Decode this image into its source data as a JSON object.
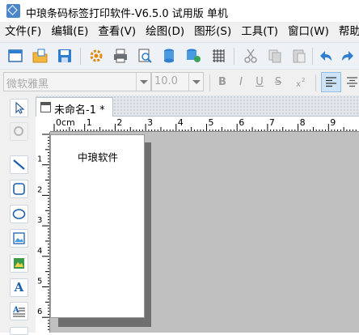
{
  "title_bar": {
    "title": "中琅条码标签打印软件-V6.5.0 试用版 单机",
    "logo_icon": "app-logo-icon"
  },
  "menu": {
    "items": [
      {
        "label": "文件(F)"
      },
      {
        "label": "编辑(E)"
      },
      {
        "label": "查看(V)"
      },
      {
        "label": "绘图(D)"
      },
      {
        "label": "图形(S)"
      },
      {
        "label": "工具(T)"
      },
      {
        "label": "窗口(W)"
      },
      {
        "label": "帮助"
      }
    ]
  },
  "toolbar": {
    "icons": [
      "new-icon",
      "open-icon",
      "save-icon",
      "settings-icon",
      "print-icon",
      "print-preview-icon",
      "database-icon",
      "database-settings-icon",
      "grid-icon",
      "cut-icon",
      "copy-icon",
      "paste-icon",
      "undo-icon",
      "redo-icon"
    ]
  },
  "format_bar": {
    "font_name": "微软雅黑",
    "font_size": "10.0",
    "bold": "B",
    "italic": "I",
    "underline": "U",
    "strike": "S",
    "superscript_icon": "superscript-icon",
    "align_left_icon": "align-left-icon",
    "align_center_icon": "align-center-icon"
  },
  "tools": {
    "icons": [
      "select-arrow-icon",
      "rotate-icon",
      "line-icon",
      "rounded-rect-icon",
      "ellipse-icon",
      "image-icon",
      "picture-icon",
      "text-icon",
      "rich-text-icon"
    ],
    "text_tool_glyph": "A"
  },
  "document": {
    "tab_title": "未命名-1 *",
    "ruler_unit": "cm",
    "ruler_numbers": [
      "0",
      "1",
      "2",
      "3",
      "4",
      "5",
      "6",
      "7",
      "8",
      "9"
    ],
    "label_text": "中琅软件"
  },
  "colors": {
    "accent": "#2f7fd0",
    "canvas_bg": "#c0c0c0",
    "selected_button": "#cde3f7"
  }
}
